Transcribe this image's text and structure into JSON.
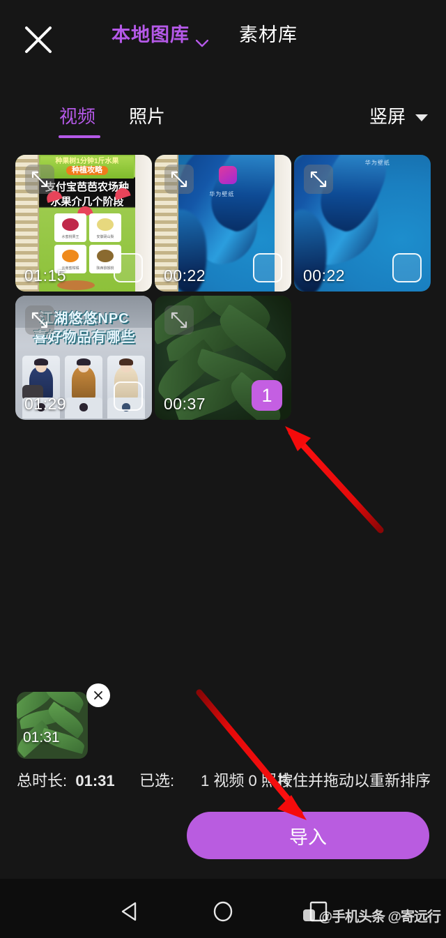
{
  "header": {
    "close_icon": "close-icon",
    "tabs": [
      {
        "label": "本地图库",
        "active": true,
        "has_chevron": true,
        "chevron_icon": "chevron-down-icon"
      },
      {
        "label": "素材库",
        "active": false,
        "has_chevron": false
      }
    ]
  },
  "subtabs": {
    "video_label": "视频",
    "photo_label": "照片",
    "orientation_label": "竖屏",
    "orientation_icon": "triangle-down-icon"
  },
  "grid": {
    "expand_icon": "expand-arrows-icon",
    "items": [
      {
        "duration": "01:15",
        "selected": false,
        "art": "notebook-fruit",
        "title": "支付宝芭芭农场种水果介几个阶段",
        "banner": "种果树1分钟1斤水果",
        "banner_pill": "种植攻略"
      },
      {
        "duration": "00:22",
        "selected": false,
        "art": "blue-notebook"
      },
      {
        "duration": "00:22",
        "selected": false,
        "art": "blue"
      },
      {
        "duration": "01:29",
        "selected": false,
        "art": "game",
        "title": "江湖悠悠NPC 喜好物品有哪些"
      },
      {
        "duration": "00:37",
        "selected": true,
        "selection_number": "1",
        "art": "plant"
      }
    ]
  },
  "selected_strip": {
    "thumb_duration": "01:31",
    "remove_icon": "close-icon"
  },
  "info": {
    "total_label": "总时长:",
    "total_value": "01:31",
    "selected_label": "已选:",
    "selected_value": "1 视频 0 照片",
    "hint": "按住并拖动以重新排序"
  },
  "import_button": {
    "label": "导入"
  },
  "navbar": {
    "back_icon": "triangle-back-icon",
    "home_icon": "circle-home-icon",
    "recents_icon": "square-recents-icon",
    "watermark": "@手机头条 @寄远行"
  },
  "annotations": {
    "arrow_color": "#f50b0b",
    "arrow_1_target": "selected-thumbnail",
    "arrow_2_target": "import-button"
  },
  "colors": {
    "accent_purple": "#b559e8",
    "button_purple": "#b95ce0",
    "badge_purple": "#c45fe2",
    "background": "#161616",
    "navbar_bg": "#0d0d0d",
    "annotation_red": "#f50b0b"
  }
}
